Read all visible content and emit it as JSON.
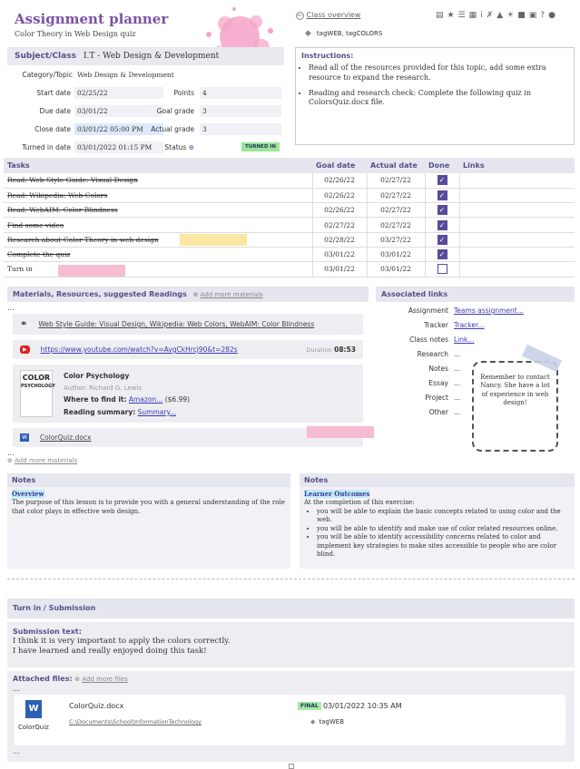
{
  "header": {
    "title": "Assignment planner",
    "subtitle": "Color Theory in Web Design quiz",
    "class_overview": "Class overview",
    "tags": "tagWEB, tagCOLORS"
  },
  "details": {
    "subject_label": "Subject/Class",
    "subject_value": "I.T - Web Design & Development",
    "category_label": "Category/Topic",
    "category_value": "Web Design & Development",
    "start_label": "Start date",
    "start_value": "02/25/22",
    "due_label": "Due date",
    "due_value": "03/01/22",
    "close_label": "Close date",
    "close_value": "03/01/22 05:00 PM",
    "turned_label": "Turned in date",
    "turned_value": "03/01/2022 01:15 PM",
    "points_label": "Points",
    "points_value": "4",
    "goal_label": "Goal grade",
    "goal_value": "3",
    "actual_label": "Actual grade",
    "actual_value": "3",
    "status_label": "Status",
    "status_value": "TURNED IN"
  },
  "instructions": {
    "title": "Instructions:",
    "items": [
      "Read all of the resources provided for this topic, add some extra resource to expand the research.",
      "Reading and research check: Complete the following quiz in ColorsQuiz.docx file."
    ]
  },
  "tasks": {
    "headers": [
      "Tasks",
      "Goal date",
      "Actual date",
      "Done",
      "Links"
    ],
    "rows": [
      {
        "task": "Read: Web Style Guide: Visual Design",
        "goal": "02/26/22",
        "actual": "02/27/22",
        "done": true
      },
      {
        "task": "Read: Wikipedia: Web Colors",
        "goal": "02/26/22",
        "actual": "02/27/22",
        "done": true
      },
      {
        "task": "Read: WebAIM: Color Blindness",
        "goal": "02/26/22",
        "actual": "02/27/22",
        "done": true
      },
      {
        "task": "Find some video",
        "goal": "02/27/22",
        "actual": "02/27/22",
        "done": true
      },
      {
        "task": "Research about Color Theory in web design",
        "goal": "02/28/22",
        "actual": "03/27/22",
        "done": true
      },
      {
        "task": "Complete the quiz",
        "goal": "03/01/22",
        "actual": "03/01/22",
        "done": true
      },
      {
        "task": "Turn in",
        "goal": "03/01/22",
        "actual": "03/01/22",
        "done": false
      }
    ]
  },
  "materials": {
    "title": "Materials, Resources, suggested Readings",
    "add_label": "Add more materials",
    "links": "Web Style Guide: Visual Design, Wikipedia: Web Colors, WebAIM: Color Blindness",
    "youtube": "https://www.youtube.com/watch?v=AvgCkHrcj90&t=282s",
    "duration_label": "Duration",
    "duration_value": "08:53",
    "book_title": "Color Psychology",
    "book_author_label": "Author:",
    "book_author": "Richard G. Lewis",
    "where_label": "Where to find it:",
    "where_link": "Amazon...",
    "price": "($6.99)",
    "summary_label": "Reading summary:",
    "summary_link": "Summary...",
    "file": "ColorQuiz.docx",
    "add_more": "Add more materials",
    "ellipsis": "..."
  },
  "assoc": {
    "title": "Associated links",
    "assignment_label": "Assignment",
    "assignment_value": "Teams assignment...",
    "tracker_label": "Tracker",
    "tracker_value": "Tracker...",
    "classnotes_label": "Class notes",
    "classnotes_value": "Link...",
    "research_label": "Research",
    "notes_label": "Notes",
    "essay_label": "Essay",
    "project_label": "Project",
    "other_label": "Other",
    "empty": "...",
    "sticky": "Remember to contact Nancy. She have a lot of experience in web design!"
  },
  "notes": {
    "title": "Notes",
    "overview_label": "Overview",
    "overview_text": "The purpose of this lesson is to provide you with a general understanding of the role that color plays in effective web design.",
    "outcomes_label": "Learner Outcomes",
    "outcomes_intro": "At the completion of this exercise:",
    "outcomes": [
      "you will be able to explain the basic concepts related to using color and the web.",
      "you will be able to identify and make use of color related resources online.",
      "you will be able to identify accessibility concerns related to color and implement key strategies to make sites accessible to people who are color blind."
    ]
  },
  "submission": {
    "title": "Turn in / Submission",
    "text_label": "Submission text:",
    "line1": "I think it is very important to apply the colors correctly.",
    "line2": "I have learned and really enjoyed doing this task!"
  },
  "attached": {
    "title": "Attached files:",
    "add_label": "Add more files",
    "file_name": "ColorQuiz.docx",
    "icon_label": "ColorQuiz",
    "path": "C:\\Documents\\School\\InformationTechnology",
    "badge": "FINAL",
    "date": "03/01/2022 10:35 AM",
    "tag": "tagWEB",
    "ellipsis": "..."
  },
  "colors": {
    "accent": "#7a52a8",
    "heading": "#55508a",
    "done_box": "#5a4a9a",
    "status_green": "#9be59b"
  }
}
